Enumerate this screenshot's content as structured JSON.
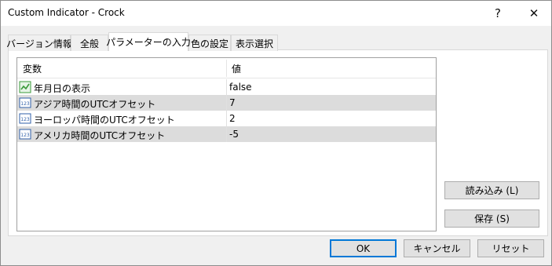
{
  "window": {
    "title": "Custom Indicator - Crock",
    "help_label": "?",
    "close_label": "✕"
  },
  "tabs": [
    {
      "label": "バージョン情報"
    },
    {
      "label": "全般"
    },
    {
      "label": "パラメーターの入力",
      "active": true
    },
    {
      "label": "色の設定"
    },
    {
      "label": "表示選択"
    }
  ],
  "grid": {
    "headers": {
      "variable": "変数",
      "value": "値"
    },
    "rows": [
      {
        "icon": "boolean-icon",
        "name": "年月日の表示",
        "value": "false"
      },
      {
        "icon": "integer-icon",
        "name": "アジア時間のUTCオフセット",
        "value": "7"
      },
      {
        "icon": "integer-icon",
        "name": "ヨーロッパ時間のUTCオフセット",
        "value": "2"
      },
      {
        "icon": "integer-icon",
        "name": "アメリカ時間のUTCオフセット",
        "value": "-5"
      }
    ]
  },
  "side_buttons": {
    "load": "読み込み (L)",
    "save": "保存 (S)"
  },
  "footer": {
    "ok": "OK",
    "cancel": "キャンセル",
    "reset": "リセット"
  },
  "colors": {
    "row_alt": "#dcdcdc",
    "accent": "#0078d7",
    "int_icon_blue": "#2f5fa8",
    "bool_icon_green": "#3a9a3a"
  }
}
